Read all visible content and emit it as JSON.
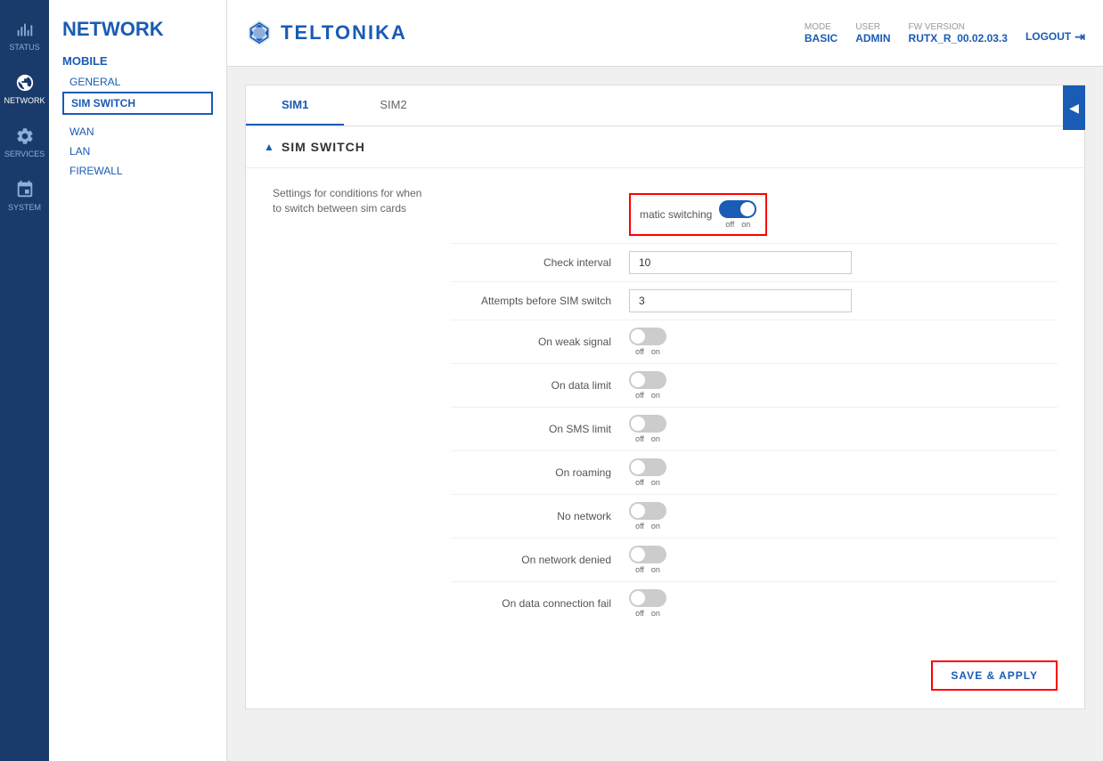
{
  "topbar": {
    "logo": "TELTONIKA",
    "mode_label": "MODE",
    "mode_value": "BASIC",
    "user_label": "USER",
    "user_value": "ADMIN",
    "fw_label": "FW VERSION",
    "fw_value": "RUTX_R_00.02.03.3",
    "logout_label": "LOGOUT"
  },
  "sidebar": {
    "items": [
      {
        "id": "status",
        "label": "STATUS",
        "icon": "status"
      },
      {
        "id": "network",
        "label": "NETWORK",
        "icon": "network",
        "active": true
      },
      {
        "id": "services",
        "label": "SERVICES",
        "icon": "services"
      },
      {
        "id": "system",
        "label": "SYSTEM",
        "icon": "system"
      }
    ]
  },
  "leftpanel": {
    "title": "NETWORK",
    "groups": [
      {
        "label": "MOBILE",
        "items": [
          {
            "label": "GENERAL",
            "active": false
          },
          {
            "label": "SIM SWITCH",
            "active": true
          }
        ]
      },
      {
        "label": "WAN",
        "items": []
      },
      {
        "label": "LAN",
        "items": []
      },
      {
        "label": "FIREWALL",
        "items": []
      }
    ]
  },
  "tabs": [
    {
      "label": "SIM1",
      "active": true
    },
    {
      "label": "SIM2",
      "active": false
    }
  ],
  "section": {
    "title": "SIM SWITCH",
    "description": "Settings for conditions for when to switch between sim cards"
  },
  "fields": {
    "auto_switching_label": "matic switching",
    "auto_switching_state": "on",
    "check_interval_label": "Check interval",
    "check_interval_value": "10",
    "attempts_label": "Attempts before SIM switch",
    "attempts_value": "3",
    "on_weak_signal_label": "On weak signal",
    "on_weak_signal_state": "off",
    "on_data_limit_label": "On data limit",
    "on_data_limit_state": "off",
    "on_sms_limit_label": "On SMS limit",
    "on_sms_limit_state": "off",
    "on_roaming_label": "On roaming",
    "on_roaming_state": "off",
    "no_network_label": "No network",
    "no_network_state": "off",
    "on_network_denied_label": "On network denied",
    "on_network_denied_state": "off",
    "on_data_conn_fail_label": "On data connection fail",
    "on_data_conn_fail_state": "off"
  },
  "save_button": "SAVE & APPLY",
  "toggle_labels": {
    "off": "off",
    "on": "on"
  }
}
